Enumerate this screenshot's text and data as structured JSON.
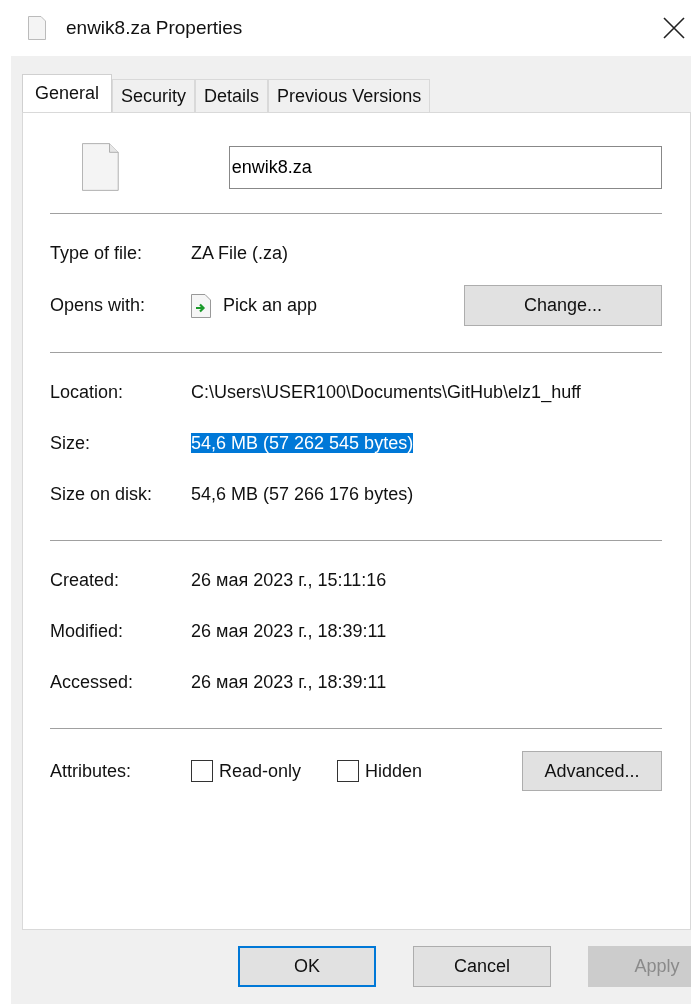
{
  "window": {
    "title": "enwik8.za Properties"
  },
  "tabs": [
    {
      "label": "General",
      "selected": true
    },
    {
      "label": "Security",
      "selected": false
    },
    {
      "label": "Details",
      "selected": false
    },
    {
      "label": "Previous Versions",
      "selected": false
    }
  ],
  "file_name": {
    "value": "enwik8.za"
  },
  "type_of_file": {
    "label": "Type of file:",
    "value": "ZA File (.za)"
  },
  "opens_with": {
    "label": "Opens with:",
    "value": "Pick an app",
    "button": "Change..."
  },
  "info": [
    {
      "label": "Location:",
      "value": "C:\\Users\\USER100\\Documents\\GitHub\\elz1_huff",
      "selected": false
    },
    {
      "label": "Size:",
      "value": "54,6 MB (57 262 545 bytes)",
      "selected": true
    },
    {
      "label": "Size on disk:",
      "value": "54,6 MB (57 266 176 bytes)",
      "selected": false
    }
  ],
  "dates": [
    {
      "label": "Created:",
      "value": "26 мая 2023 г., 15:11:16"
    },
    {
      "label": "Modified:",
      "value": "26 мая 2023 г., 18:39:11"
    },
    {
      "label": "Accessed:",
      "value": "26 мая 2023 г., 18:39:11"
    }
  ],
  "attributes": {
    "label": "Attributes:",
    "checkboxes": [
      {
        "label": "Read-only",
        "checked": false
      },
      {
        "label": "Hidden",
        "checked": false
      }
    ],
    "button": "Advanced..."
  },
  "buttons": [
    {
      "label": "OK",
      "default": true,
      "disabled": false
    },
    {
      "label": "Cancel",
      "default": false,
      "disabled": false
    },
    {
      "label": "Apply",
      "default": false,
      "disabled": true
    }
  ]
}
